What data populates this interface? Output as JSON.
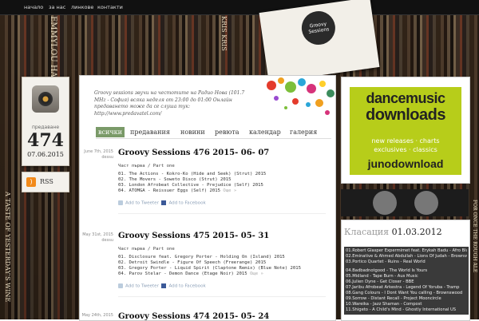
{
  "nav": {
    "items": [
      "начало",
      "за нас",
      "линкове",
      "контакти"
    ]
  },
  "record_label": {
    "line1": "Groovy",
    "line2": "Sessions"
  },
  "background_spines": [
    "EMMYLOU HARRIS",
    "A TASTE OF YESTERDAY'S WINE",
    "KRIS KRIS",
    "FOR ONCE THE ROUGH ALE"
  ],
  "edition": {
    "label": "предаване",
    "number": "474",
    "date": "07.06.2015"
  },
  "rss": {
    "label": "RSS"
  },
  "tagline": "Groovy sessions звучи на честотите на Радио Нова (101.7 MHz - София) всяка неделя от 23:00 до 01:00 Онлайн предаването може да се слуша тук: http://www.predavatel.com/",
  "tabs": [
    "всички",
    "предавания",
    "новини",
    "ревюта",
    "календар",
    "галерия"
  ],
  "active_tab": "всички",
  "posts": [
    {
      "date": "June 7th, 2015",
      "author": "dessu",
      "title": "Groovy Sessions 476 2015- 06- 07",
      "sub": "Част първа / Part one",
      "lines": [
        "01. The Actions - Kokro-Ko (Hide and Seek) (Strut) 2015",
        "02. The Movers - Soweto Disco (Strut) 2015",
        "03. London Afrobeat Collective - Prejudice (Self) 2015",
        "04. ATOMGA - Reissuer Eggs (Self) 2015"
      ],
      "more": "Още »",
      "tweet": "Add to Tweeter",
      "facebook": "Add to Facebook"
    },
    {
      "date": "May 31st, 2015",
      "author": "dessu",
      "title": "Groovy Sessions 475 2015- 05- 31",
      "sub": "Част първа / Part one",
      "lines": [
        "01. Disclosure feat. Gregory Porter - Holding On (Island) 2015",
        "02. Detroit Swindle - Figure Of Speech (Freerange) 2015",
        "03. Gregory Porter - Liquid Spirit (Claptone Remix) (Blue Note) 2015",
        "04. Parov Stelar - Demon Dance (Etage Noir) 2015"
      ],
      "more": "Още »",
      "tweet": "Add to Tweeter",
      "facebook": "Add to Facebook"
    },
    {
      "date": "May 24th, 2015",
      "author": "",
      "title": "Groovy Sessions 474 2015- 05- 24",
      "sub": "",
      "lines": [],
      "more": "",
      "tweet": "",
      "facebook": ""
    }
  ],
  "ad": {
    "line1": "dancemusic",
    "line2": "downloads",
    "line3a": "new releases · charts",
    "line3b": "exclusives · classics",
    "line4": "junodownload"
  },
  "chart": {
    "label": "Класация",
    "date": "01.03.2012",
    "group1": [
      "01.Robert Glasper Expermimet feat. Erykah Badu - Afro Blue - Blue Note",
      "02.Eminative & Ahmed Abdullah - Lions Of Judah - Brownswood",
      "03.Portico Quartet - Ruins - Real World"
    ],
    "group2": [
      "04.Badbadnotgood - The World Is Yours",
      "05.Midland - Tape Burn - Aus Music",
      "06.Julien Dyne - Get Closer - BBE",
      "07.Jaribu Afrobeat Arkestra - Legend Of Yoruba - Tramp",
      "08.Gang Colours - I Dont Want You calling - Brownswood",
      "09.Sorrow - Distant Recall - Project Mooncircle",
      "10.Wareika - Jazz Shaman - Compost",
      "11.Shigeto - A Child's Mind - Ghostly International US"
    ]
  },
  "colors": {
    "active_tab": "#7a9a68",
    "ad_green": "#b7cd1a",
    "rss_orange": "#f28a1a"
  }
}
